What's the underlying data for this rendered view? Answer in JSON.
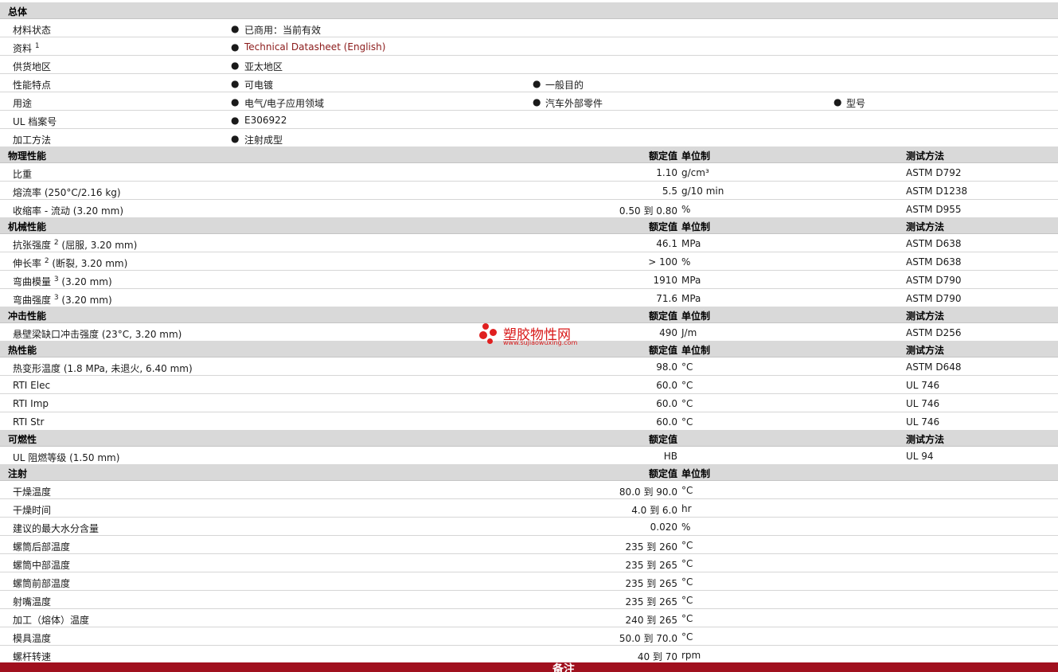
{
  "general": {
    "title": "总体",
    "material_status": {
      "label": "材料状态",
      "value": "已商用：当前有效"
    },
    "data": {
      "label": "资料",
      "sup": "1",
      "value": "Technical Datasheet (English)"
    },
    "region": {
      "label": "供货地区",
      "value": "亚太地区"
    },
    "features": {
      "label": "性能特点",
      "values": [
        "可电镀",
        "一般目的"
      ]
    },
    "uses": {
      "label": "用途",
      "values": [
        "电气/电子应用领域",
        "汽车外部零件",
        "型号"
      ]
    },
    "ul": {
      "label": "UL 档案号",
      "value": "E306922"
    },
    "processing": {
      "label": "加工方法",
      "value": "注射成型"
    }
  },
  "headers": {
    "nominal": "额定值",
    "unit": "单位制",
    "test": "测试方法"
  },
  "physical": {
    "title": "物理性能",
    "rows": [
      {
        "label": "比重",
        "value": "1.10",
        "unit": "g/cm³",
        "test": "ASTM D792"
      },
      {
        "label": "熔流率  (250°C/2.16 kg)",
        "value": "5.5",
        "unit": "g/10 min",
        "test": "ASTM D1238"
      },
      {
        "label": "收缩率  - 流动  (3.20 mm)",
        "value": "0.50 到  0.80",
        "unit": "%",
        "test": "ASTM D955"
      }
    ]
  },
  "mechanical": {
    "title": "机械性能",
    "rows": [
      {
        "label": "抗张强度",
        "sup": "2",
        "extra": " (屈服, 3.20 mm)",
        "value": "46.1",
        "unit": "MPa",
        "test": "ASTM D638"
      },
      {
        "label": "伸长率",
        "sup": "2",
        "extra": " (断裂, 3.20 mm)",
        "value": "> 100",
        "unit": "%",
        "test": "ASTM D638"
      },
      {
        "label": "弯曲模量",
        "sup": "3",
        "extra": " (3.20 mm)",
        "value": "1910",
        "unit": "MPa",
        "test": "ASTM D790"
      },
      {
        "label": "弯曲强度",
        "sup": "3",
        "extra": " (3.20 mm)",
        "value": "71.6",
        "unit": "MPa",
        "test": "ASTM D790"
      }
    ]
  },
  "impact": {
    "title": "冲击性能",
    "rows": [
      {
        "label": "悬壁梁缺口冲击强度  (23°C, 3.20 mm)",
        "value": "490",
        "unit": "J/m",
        "test": "ASTM D256"
      }
    ]
  },
  "thermal": {
    "title": "热性能",
    "rows": [
      {
        "label": "热变形温度  (1.8 MPa, 未退火, 6.40 mm)",
        "value": "98.0",
        "unit": "°C",
        "test": "ASTM D648"
      },
      {
        "label": "RTI Elec",
        "value": "60.0",
        "unit": "°C",
        "test": "UL 746"
      },
      {
        "label": "RTI Imp",
        "value": "60.0",
        "unit": "°C",
        "test": "UL 746"
      },
      {
        "label": "RTI Str",
        "value": "60.0",
        "unit": "°C",
        "test": "UL 746"
      }
    ]
  },
  "flammability": {
    "title": "可燃性",
    "rows": [
      {
        "label": "UL 阻燃等级  (1.50 mm)",
        "value": "HB",
        "test": "UL 94"
      }
    ]
  },
  "injection": {
    "title": "注射",
    "rows": [
      {
        "label": "干燥温度",
        "value": "80.0 到  90.0",
        "unit": "°C"
      },
      {
        "label": "干燥时间",
        "value": "4.0 到  6.0",
        "unit": "hr"
      },
      {
        "label": "建议的最大水分含量",
        "value": "0.020",
        "unit": "%"
      },
      {
        "label": "螺筒后部温度",
        "value": "235 到  260",
        "unit": "°C"
      },
      {
        "label": "螺筒中部温度",
        "value": "235 到  265",
        "unit": "°C"
      },
      {
        "label": "螺筒前部温度",
        "value": "235 到  265",
        "unit": "°C"
      },
      {
        "label": "射嘴温度",
        "value": "235 到  265",
        "unit": "°C"
      },
      {
        "label": "加工（熔体）温度",
        "value": "240 到  265",
        "unit": "°C"
      },
      {
        "label": "模具温度",
        "value": "50.0 到  70.0",
        "unit": "°C"
      },
      {
        "label": "螺杆转速",
        "value": "40 到  70",
        "unit": "rpm"
      }
    ]
  },
  "footer": {
    "title": "备注"
  },
  "watermark": {
    "name": "塑胶物性网",
    "url": "www.sujiaowuxing.com",
    "color": "#d81818"
  },
  "colors": {
    "section_bg": "#d9d9d9",
    "link": "#8b1a1a",
    "footer_bg": "#a0101e"
  }
}
